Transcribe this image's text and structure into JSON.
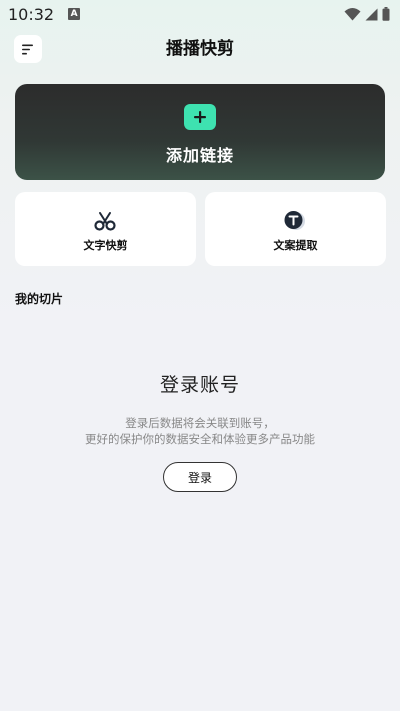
{
  "status_bar": {
    "time": "10:32",
    "notification_glyph": "A",
    "icons": [
      "wifi-icon",
      "signal-icon",
      "battery-icon"
    ]
  },
  "header": {
    "title": "播播快剪",
    "menu_icon": "menu-icon"
  },
  "add_link": {
    "label": "添加链接",
    "icon": "plus-icon",
    "accent_color": "#3EE2B0"
  },
  "features": [
    {
      "label": "文字快剪",
      "icon": "scissors-icon"
    },
    {
      "label": "文案提取",
      "icon": "text-extract-icon"
    }
  ],
  "my_clips": {
    "title": "我的切片"
  },
  "login": {
    "title": "登录账号",
    "desc_line1": "登录后数据将会关联到账号，",
    "desc_line2": "更好的保护你的数据安全和体验更多产品功能",
    "button_label": "登录"
  }
}
